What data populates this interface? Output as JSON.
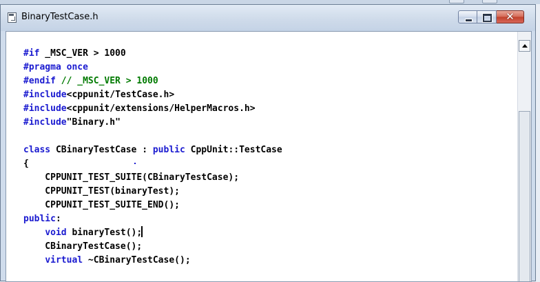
{
  "window": {
    "title": "BinaryTestCase.h",
    "icons": {
      "document": "document-icon",
      "minimize": "minimize-icon",
      "maximize": "maximize-icon",
      "close": "close-icon",
      "scroll_up": "scroll-up-arrow-icon"
    },
    "close_glyph": "✕"
  },
  "colors": {
    "keyword": "#1a1ad0",
    "comment": "#007a00",
    "text": "#000000",
    "close_button": "#c0402a"
  },
  "editor": {
    "lines": [
      [
        {
          "t": "kw",
          "s": "#if"
        },
        {
          "t": "tx",
          "s": " _MSC_VER > 1000"
        }
      ],
      [
        {
          "t": "kw",
          "s": "#pragma once"
        }
      ],
      [
        {
          "t": "kw",
          "s": "#endif"
        },
        {
          "t": "cm",
          "s": " // _MSC_VER > 1000"
        }
      ],
      [
        {
          "t": "kw",
          "s": "#include"
        },
        {
          "t": "tx",
          "s": "<cppunit/TestCase.h>"
        }
      ],
      [
        {
          "t": "kw",
          "s": "#include"
        },
        {
          "t": "tx",
          "s": "<cppunit/extensions/HelperMacros.h>"
        }
      ],
      [
        {
          "t": "kw",
          "s": "#include"
        },
        {
          "t": "tx",
          "s": "\"Binary.h\""
        }
      ],
      [],
      [
        {
          "t": "kw",
          "s": "class"
        },
        {
          "t": "tx",
          "s": " CBinaryTestCase : "
        },
        {
          "t": "kw",
          "s": "public"
        },
        {
          "t": "tx",
          "s": " CppUnit::TestCase"
        }
      ],
      [
        {
          "t": "tx",
          "s": "{"
        }
      ],
      [
        {
          "t": "tx",
          "s": "    CPPUNIT_TEST_SUITE(CBinaryTestCase);"
        }
      ],
      [
        {
          "t": "tx",
          "s": "    CPPUNIT_TEST(binaryTest);"
        }
      ],
      [
        {
          "t": "tx",
          "s": "    CPPUNIT_TEST_SUITE_END();"
        }
      ],
      [
        {
          "t": "kw",
          "s": "public"
        },
        {
          "t": "tx",
          "s": ":"
        }
      ],
      [
        {
          "t": "tx",
          "s": "    "
        },
        {
          "t": "kw",
          "s": "void"
        },
        {
          "t": "tx",
          "s": " binaryTest();"
        },
        {
          "t": "caret",
          "s": ""
        }
      ],
      [
        {
          "t": "tx",
          "s": "    CBinaryTestCase();"
        }
      ],
      [
        {
          "t": "tx",
          "s": "    "
        },
        {
          "t": "kw",
          "s": "virtual"
        },
        {
          "t": "tx",
          "s": " ~CBinaryTestCase();"
        }
      ]
    ]
  }
}
